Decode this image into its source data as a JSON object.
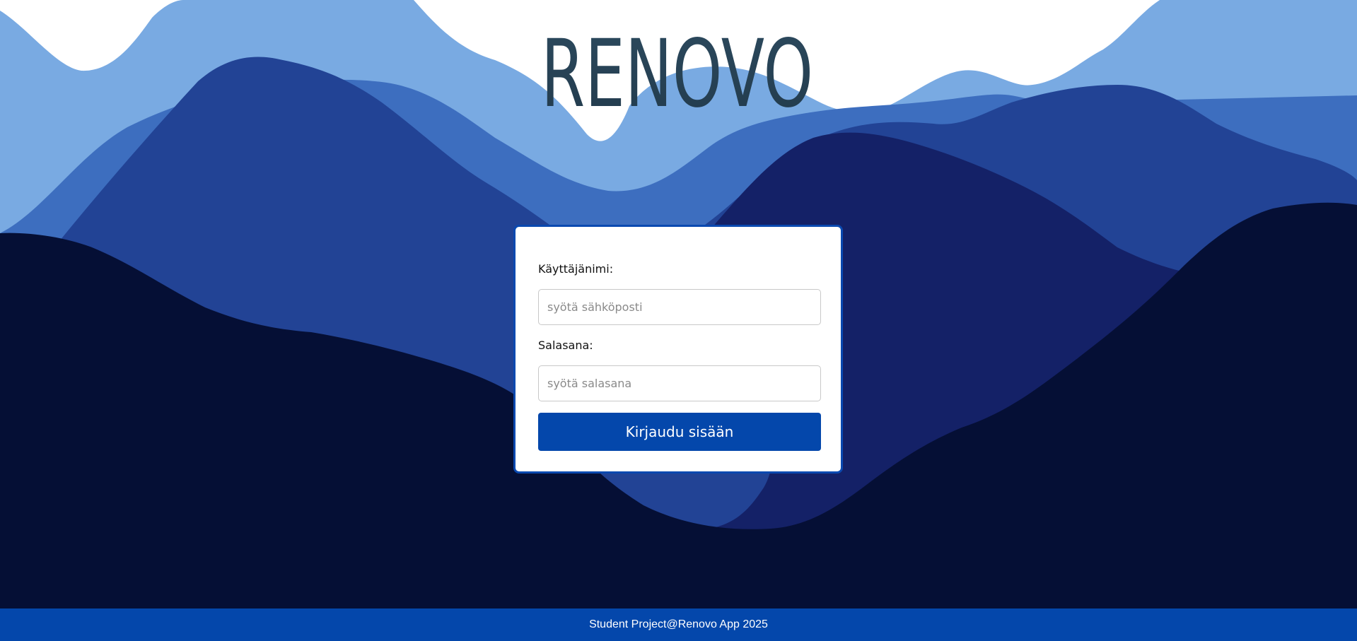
{
  "app": {
    "logo_text": "RENOVO"
  },
  "login_form": {
    "username_label": "Käyttäjänimi:",
    "username_placeholder": "syötä sähköposti",
    "username_value": "",
    "password_label": "Salasana:",
    "password_placeholder": "syötä salasana",
    "password_value": "",
    "submit_label": "Kirjaudu sisään"
  },
  "footer": {
    "text": "Student Project@Renovo App 2025"
  },
  "colors": {
    "sky": "#ffffff",
    "mountain_light": "#79aae2",
    "mountain_mid": "#3d6ebf",
    "mountain_royal": "#224395",
    "mountain_navy": "#142167",
    "mountain_night": "#050f35",
    "logo": "#2c4a5e",
    "accent": "#0447ab"
  }
}
